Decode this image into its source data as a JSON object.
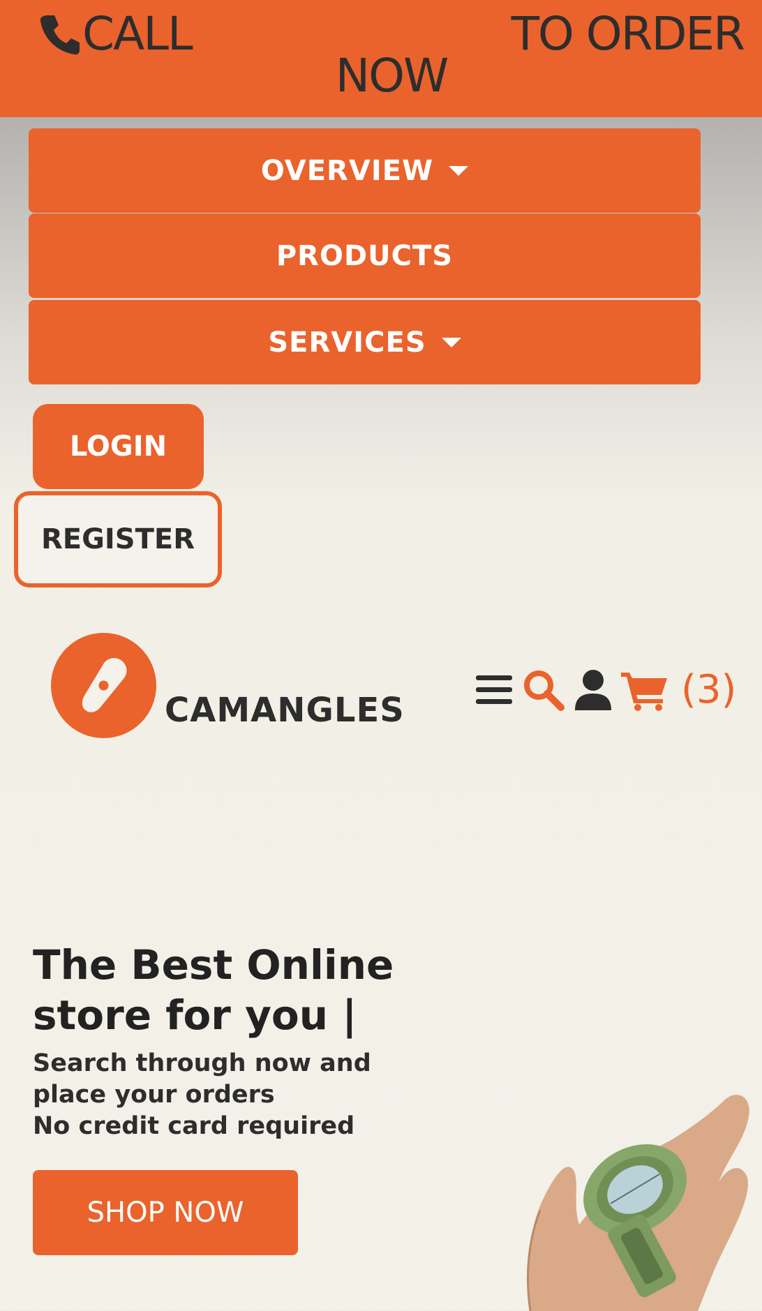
{
  "topbar": {
    "call_label": "CALL",
    "order_label": "TO ORDER",
    "now_label": "NOW",
    "icon": "phone-icon"
  },
  "nav": {
    "items": [
      {
        "label": "OVERVIEW",
        "has_dropdown": true
      },
      {
        "label": "PRODUCTS",
        "has_dropdown": false
      },
      {
        "label": "SERVICES",
        "has_dropdown": true
      }
    ]
  },
  "auth": {
    "login_label": "LOGIN",
    "register_label": "REGISTER"
  },
  "header": {
    "brand": "CAMANGLES",
    "logo_icon": "compass-icon",
    "icons": [
      "menu-icon",
      "search-icon",
      "user-icon",
      "cart-icon"
    ],
    "cart_count": "(3)"
  },
  "hero": {
    "title": "The Best Online store for you |",
    "subtitle_line1": "Search through now and place your orders",
    "subtitle_line2": "No credit card required",
    "cta_label": "SHOP NOW"
  },
  "colors": {
    "accent": "#ea632c",
    "text_dark": "#2d2d2d",
    "background": "#f3f1e8"
  }
}
